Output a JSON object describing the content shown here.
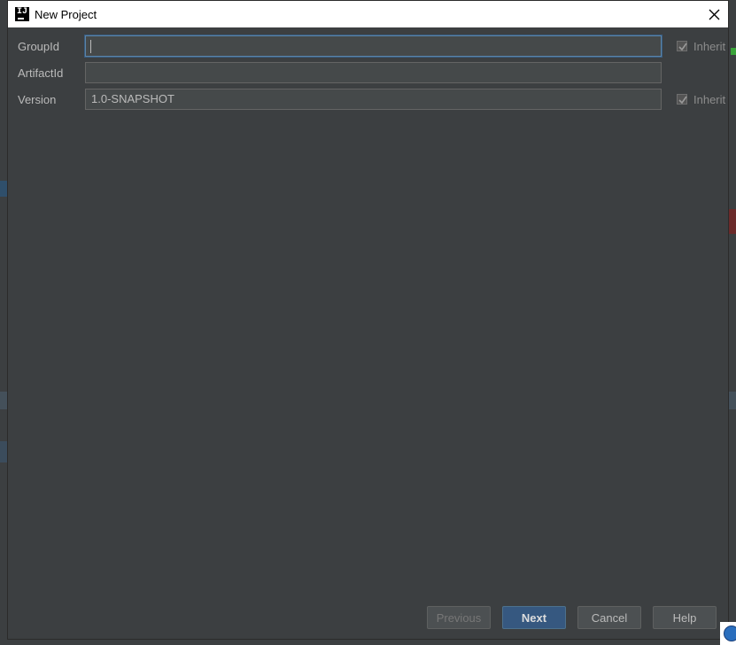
{
  "dialog": {
    "title": "New Project",
    "app_icon_text": "IJ"
  },
  "form": {
    "groupid": {
      "label": "GroupId",
      "value": "",
      "inherit_label": "Inherit",
      "inherit_checked": true
    },
    "artifactid": {
      "label": "ArtifactId",
      "value": ""
    },
    "version": {
      "label": "Version",
      "value": "1.0-SNAPSHOT",
      "inherit_label": "Inherit",
      "inherit_checked": true
    }
  },
  "buttons": {
    "previous": "Previous",
    "next": "Next",
    "cancel": "Cancel",
    "help": "Help"
  },
  "colors": {
    "background": "#3c3f41",
    "field_background": "#45494a",
    "focus_border": "#5b84a8",
    "primary_button": "#365880"
  }
}
